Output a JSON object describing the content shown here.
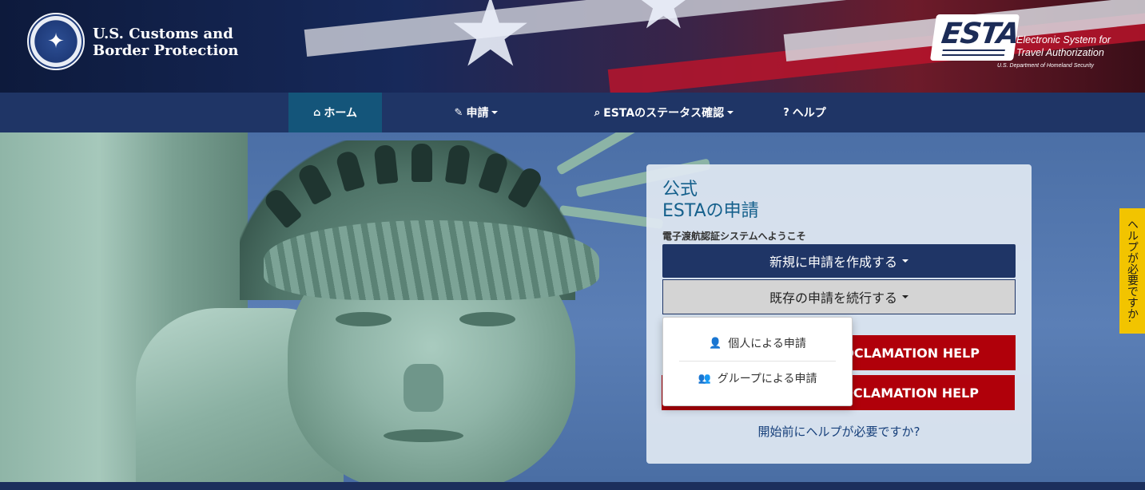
{
  "header": {
    "cbp_line1": "U.S. Customs and",
    "cbp_line2": "Border Protection",
    "esta_logo_word": "ESTA",
    "esta_tagline1": "Electronic System for",
    "esta_tagline2": "Travel Authorization",
    "esta_dept": "U.S. Department of Homeland Security"
  },
  "nav": {
    "items": [
      {
        "label": "ホーム",
        "icon": "home-icon",
        "active": true
      },
      {
        "label": "申請",
        "icon": "pencil-icon",
        "dropdown": true
      },
      {
        "label": "ESTAのステータス確認",
        "icon": "search-icon",
        "dropdown": true
      },
      {
        "label": "ヘルプ",
        "icon": "question-icon"
      }
    ]
  },
  "card": {
    "title_line1": "公式",
    "title_line2": "ESTAの申請",
    "subtitle": "電子渡航認証システムへようこそ",
    "new_app_label": "新規に申請を作成する",
    "continue_label": "既存の申請を続行する",
    "proclamation_help1": "ROCLAMATION HELP",
    "proclamation_help2": "ROCLAMATION HELP",
    "help_link": "開始前にヘルプが必要ですか?"
  },
  "dropdown": {
    "items": [
      {
        "label": "個人による申請",
        "icon": "user-icon"
      },
      {
        "label": "グループによる申請",
        "icon": "users-icon"
      }
    ]
  },
  "side_tab": {
    "label": "ヘルプが必要ですか."
  },
  "colors": {
    "nav_bg": "#1f3566",
    "nav_active": "#14557a",
    "primary_button": "#1f3566",
    "danger_button": "#b0000a",
    "side_tab": "#f2c400",
    "title_color": "#15608c"
  }
}
